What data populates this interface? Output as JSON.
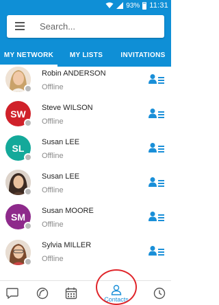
{
  "statusbar": {
    "battery_pct": "93%",
    "time": "11:31"
  },
  "search": {
    "placeholder": "Search..."
  },
  "tabs": [
    {
      "label": "MY NETWORK",
      "active": true
    },
    {
      "label": "MY LISTS",
      "active": false
    },
    {
      "label": "INVITATIONS",
      "active": false
    }
  ],
  "contacts": [
    {
      "name": "Robin ANDERSON",
      "status": "Offline",
      "avatar": "photo",
      "initials": ""
    },
    {
      "name": "Steve WILSON",
      "status": "Offline",
      "avatar": "initials",
      "initials": "SW",
      "color": "#d0212a"
    },
    {
      "name": "Susan LEE",
      "status": "Offline",
      "avatar": "initials",
      "initials": "SL",
      "color": "#14a99a"
    },
    {
      "name": "Susan LEE",
      "status": "Offline",
      "avatar": "photo",
      "initials": ""
    },
    {
      "name": "Susan MOORE",
      "status": "Offline",
      "avatar": "initials",
      "initials": "SM",
      "color": "#8e2a8b"
    },
    {
      "name": "Sylvia MILLER",
      "status": "Offline",
      "avatar": "photo",
      "initials": ""
    }
  ],
  "bottom_nav": {
    "items": [
      {
        "icon": "chat-bubble-icon",
        "label": ""
      },
      {
        "icon": "recent-icon",
        "label": ""
      },
      {
        "icon": "calendar-icon",
        "label": ""
      },
      {
        "icon": "contacts-icon",
        "label": "Contacts",
        "active": true
      },
      {
        "icon": "clock-icon",
        "label": ""
      }
    ]
  },
  "colors": {
    "primary": "#0f8fd6",
    "accent": "#1a8fd8",
    "offline": "#b9b9b9",
    "highlight": "#e0252a"
  }
}
